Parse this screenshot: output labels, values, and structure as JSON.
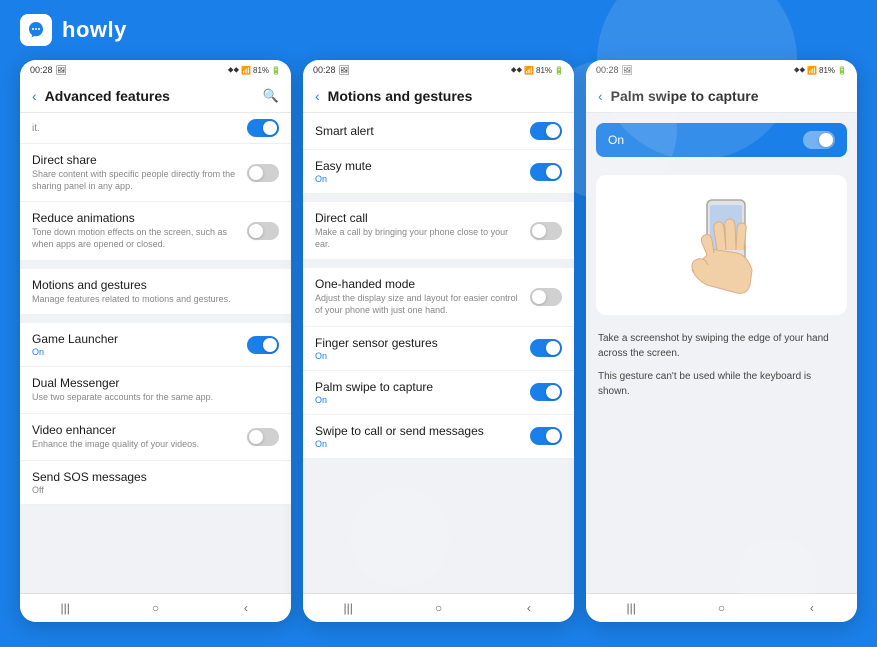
{
  "brand": {
    "logo_unicode": "🐱",
    "name": "howly"
  },
  "phone1": {
    "status_bar": {
      "time": "00:28",
      "icons": "▪▪",
      "signal": "📶",
      "battery": "81%"
    },
    "title": "Advanced features",
    "partial_label": "it.",
    "items": [
      {
        "title": "Direct share",
        "desc": "Share content with specific people directly from the sharing panel in any app.",
        "toggle": "off",
        "status": ""
      },
      {
        "title": "Reduce animations",
        "desc": "Tone down motion effects on the screen, such as when apps are opened or closed.",
        "toggle": "off",
        "status": ""
      },
      {
        "title": "Motions and gestures",
        "desc": "Manage features related to motions and gestures.",
        "toggle": "",
        "status": ""
      },
      {
        "title": "Game Launcher",
        "desc": "",
        "toggle": "on",
        "status_label": "On",
        "status_type": "on"
      },
      {
        "title": "Dual Messenger",
        "desc": "Use two separate accounts for the same app.",
        "toggle": "",
        "status": ""
      },
      {
        "title": "Video enhancer",
        "desc": "Enhance the image quality of your videos.",
        "toggle": "off",
        "status": ""
      },
      {
        "title": "Send SOS messages",
        "desc": "",
        "toggle": "",
        "status_label": "Off",
        "status_type": "off"
      }
    ],
    "nav": [
      "|||",
      "○",
      "‹"
    ]
  },
  "phone2": {
    "status_bar": {
      "time": "00:28",
      "battery": "81%"
    },
    "title": "Motions and gestures",
    "items": [
      {
        "title": "Smart alert",
        "desc": "",
        "toggle": "on",
        "status_label": "",
        "status_type": ""
      },
      {
        "title": "Easy mute",
        "desc": "",
        "toggle": "on",
        "status_label": "On",
        "status_type": "on"
      },
      {
        "title": "Direct call",
        "desc": "Make a call by bringing your phone close to your ear.",
        "toggle": "off",
        "status_label": "",
        "status_type": ""
      },
      {
        "title": "One-handed mode",
        "desc": "Adjust the display size and layout for easier control of your phone with just one hand.",
        "toggle": "off",
        "status_label": "",
        "status_type": ""
      },
      {
        "title": "Finger sensor gestures",
        "desc": "",
        "toggle": "on",
        "status_label": "On",
        "status_type": "on"
      },
      {
        "title": "Palm swipe to capture",
        "desc": "",
        "toggle": "on",
        "status_label": "On",
        "status_type": "on"
      },
      {
        "title": "Swipe to call or send messages",
        "desc": "",
        "toggle": "on",
        "status_label": "On",
        "status_type": "on"
      }
    ],
    "nav": [
      "|||",
      "○",
      "‹"
    ]
  },
  "phone3": {
    "status_bar": {
      "time": "00:28",
      "battery": "81%"
    },
    "title": "Palm swipe to capture",
    "on_label": "On",
    "desc1": "Take a screenshot by swiping the edge of your hand across the screen.",
    "desc2": "This gesture can't be used while the keyboard is shown.",
    "nav": [
      "|||",
      "○",
      "‹"
    ]
  }
}
